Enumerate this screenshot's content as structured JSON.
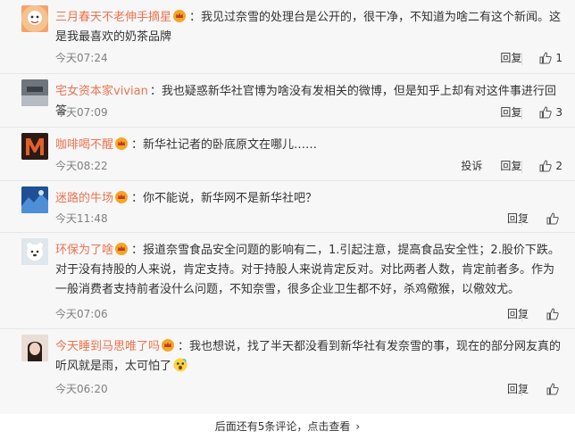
{
  "comments": [
    {
      "user": "三月春天不老伸手摘星",
      "text": "：我见过奈雪的处理台是公开的，很干净，不知道为啥二有这个新闻。这是我最喜欢的奶茶品牌",
      "time": "今天07:24",
      "reply": "回复",
      "likes": "1",
      "avatar_color": "#f3a36b"
    },
    {
      "user": "宅女资本家vivian",
      "text": "：我也疑惑新华社官博为啥没有发相关的微博，但是知乎上却有对这件事进行回答",
      "time": "今天07:09",
      "reply": "回复",
      "likes": "3",
      "avatar_color": "#8a8f96"
    },
    {
      "user": "咖啡喝不醒",
      "text": "：新华社记者的卧底原文在哪儿……",
      "time": "今天08:22",
      "report": "投诉",
      "reply": "回复",
      "likes": "2",
      "avatar_color": "#b3471f"
    },
    {
      "user": "迷路的牛场",
      "text": "：你不能说，新华网不是新华社吧？",
      "time": "今天11:48",
      "reply": "回复",
      "likes": "",
      "avatar_color": "#2a5fa8"
    },
    {
      "user": "环保为了啥",
      "text": "：报道奈雪食品安全问题的影响有二，1.引起注意，提高食品安全性；2.股价下跌。对于没有持股的人来说，肯定支持。对于持股人来说肯定反对。对比两者人数，肯定前者多。作为一般消费者支持前者没什么问题，不知奈雪，很多企业卫生都不好，杀鸡儆猴，以儆效尤。",
      "time": "今天07:06",
      "reply": "回复",
      "likes": "",
      "avatar_color": "#c9d3dc"
    },
    {
      "user": "今天睡到马思唯了吗",
      "text": "：我也想说，找了半天都没看到新华社有发奈雪的事，现在的部分网友真的听风就是雨，太可怕了",
      "time": "今天06:20",
      "reply": "回复",
      "likes": "",
      "avatar_color": "#d8c4b8"
    }
  ],
  "footer": {
    "more_label": "后面还有5条评论，点击查看",
    "chevron": "›"
  },
  "colors": {
    "username": "#eb7350",
    "background": "#f7f7f7",
    "muted": "#808080"
  },
  "icons": {
    "crown": "crown-icon",
    "thumb": "thumb-up-icon",
    "emoji": "scared-emoji-icon"
  }
}
